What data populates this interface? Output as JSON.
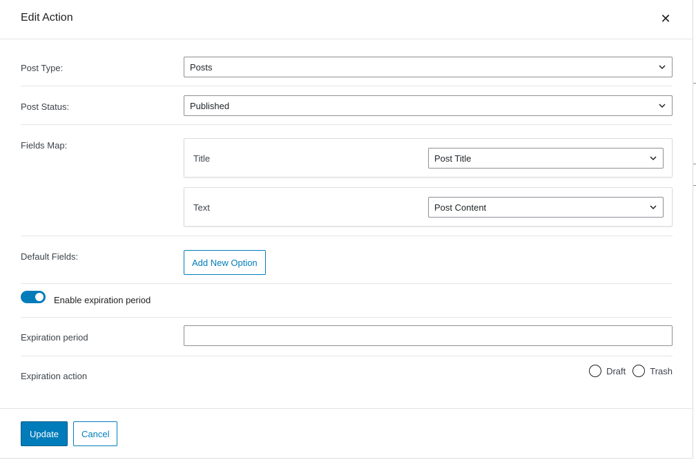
{
  "modal": {
    "title": "Edit Action",
    "close_glyph": "✕"
  },
  "fields": {
    "post_type": {
      "label": "Post Type:",
      "value": "Posts"
    },
    "post_status": {
      "label": "Post Status:",
      "value": "Published"
    },
    "fields_map": {
      "label": "Fields Map:",
      "items": [
        {
          "field": "Title",
          "value": "Post Title"
        },
        {
          "field": "Text",
          "value": "Post Content"
        }
      ]
    },
    "default_fields": {
      "label": "Default Fields:",
      "button_label": "Add New Option"
    },
    "expiration_toggle": {
      "label": "Enable expiration period",
      "enabled": true
    },
    "expiration_period": {
      "label": "Expiration period",
      "value": "",
      "placeholder": ""
    },
    "expiration_action": {
      "label": "Expiration action",
      "options": [
        {
          "label": "Draft"
        },
        {
          "label": "Trash"
        }
      ]
    }
  },
  "footer": {
    "update_label": "Update",
    "cancel_label": "Cancel"
  },
  "colors": {
    "accent": "#007cba",
    "border": "#8c8f94",
    "divider": "#e2e4e7"
  },
  "icons": {
    "close": "close-icon",
    "chevron": "chevron-down-icon"
  }
}
